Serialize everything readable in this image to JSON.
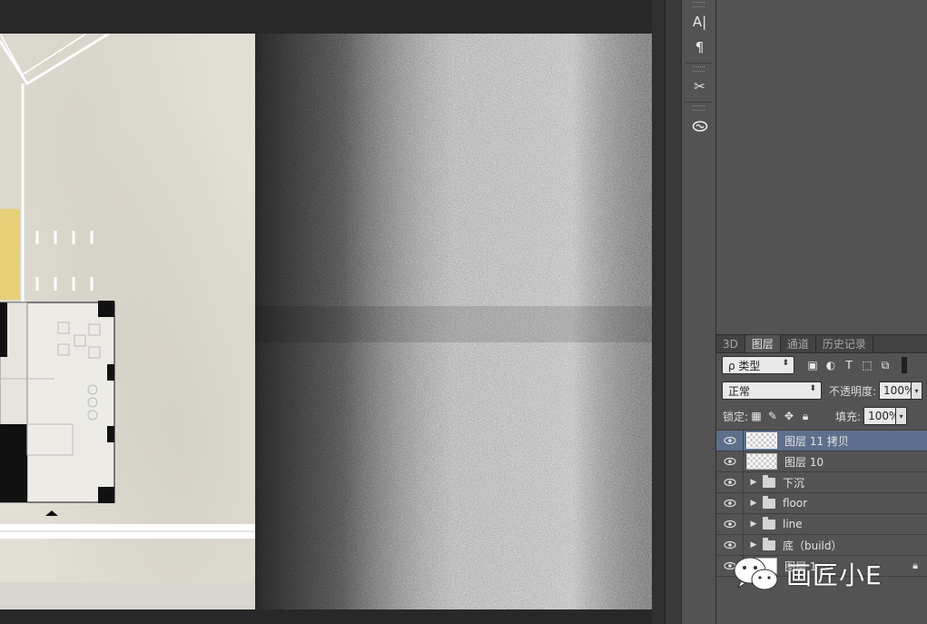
{
  "toolbar": {
    "tools": [
      {
        "name": "character-panel",
        "glyph": "A|"
      },
      {
        "name": "paragraph-panel",
        "glyph": "¶"
      },
      {
        "name": "tool-presets",
        "glyph": "✂"
      },
      {
        "name": "creative-cloud",
        "glyph": "∞"
      }
    ]
  },
  "layers_panel": {
    "tabs": [
      "3D",
      "图层",
      "通道",
      "历史记录"
    ],
    "active_tab": "图层",
    "filter": {
      "label": "ρ 类型"
    },
    "blend_mode": "正常",
    "opacity_label": "不透明度:",
    "opacity_value": "100%",
    "lock_label": "锁定:",
    "fill_label": "填充:",
    "fill_value": "100%",
    "layers": [
      {
        "name": "图层 11 拷贝",
        "type": "pixel",
        "selected": true
      },
      {
        "name": "图层 10",
        "type": "pixel",
        "selected": false
      },
      {
        "name": "下沉",
        "type": "group",
        "selected": false
      },
      {
        "name": "floor",
        "type": "group",
        "selected": false
      },
      {
        "name": "line",
        "type": "group",
        "selected": false
      },
      {
        "name": "底（build）",
        "type": "group",
        "selected": false
      },
      {
        "name": "图层 1",
        "type": "pixel",
        "selected": false,
        "locked": true
      }
    ]
  },
  "watermark": {
    "text": "画匠小E"
  },
  "colors": {
    "panel_bg": "#535353",
    "selection": "#5d6f8c",
    "canvas_bg": "#282828",
    "plan_yellow": "#e8cf6a"
  }
}
